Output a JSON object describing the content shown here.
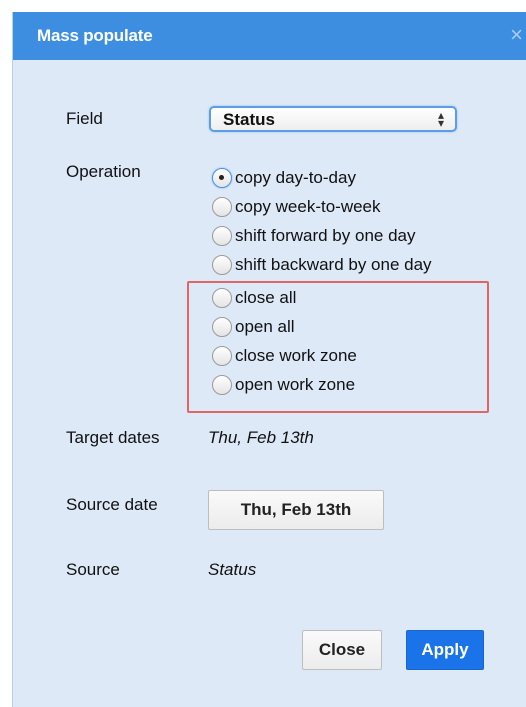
{
  "dialog": {
    "title": "Mass populate",
    "close_glyph": "×"
  },
  "field": {
    "label": "Field",
    "selected": "Status",
    "arrows_glyph": "⇕"
  },
  "operation": {
    "label": "Operation",
    "selected_index": 0,
    "options": [
      "copy day-to-day",
      "copy week-to-week",
      "shift forward by one day",
      "shift backward by one day",
      "close all",
      "open all",
      "close work zone",
      "open work zone"
    ]
  },
  "target_dates": {
    "label": "Target dates",
    "value": "Thu, Feb 13th"
  },
  "source_date": {
    "label": "Source date",
    "button": "Thu, Feb 13th"
  },
  "source": {
    "label": "Source",
    "value": "Status"
  },
  "footer": {
    "close_label": "Close",
    "apply_label": "Apply"
  },
  "colors": {
    "title_bar": "#3d8ee0",
    "dialog_bg": "#dde9f7",
    "highlight": "#e06666",
    "apply_bg": "#1a73e8"
  }
}
